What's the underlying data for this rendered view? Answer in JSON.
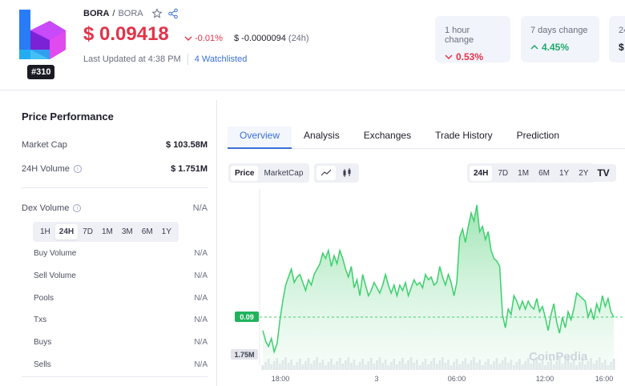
{
  "coin": {
    "name": "BORA",
    "separator": "/",
    "symbol": "BORA",
    "rank": "#310",
    "price": "$ 0.09418",
    "change_pct": "-0.01%",
    "change_abs": "$ -0.0000094",
    "change_abs_timeframe": "(24h)",
    "last_updated": "Last Updated at 4:38 PM",
    "watchlisted": "4 Watchlisted"
  },
  "stat_cards": [
    {
      "label": "1 hour change",
      "value": "0.53%",
      "direction": "down"
    },
    {
      "label": "7 days change",
      "value": "4.45%",
      "direction": "up"
    },
    {
      "label": "24",
      "value": "$"
    }
  ],
  "performance": {
    "title": "Price Performance",
    "market_cap_label": "Market Cap",
    "market_cap": "$ 103.58M",
    "volume_label": "24H Volume",
    "volume": "$ 1.751M",
    "dex_label": "Dex Volume",
    "dex_value": "N/A",
    "timeframes": [
      "1H",
      "24H",
      "7D",
      "1M",
      "3M",
      "6M",
      "1Y"
    ],
    "active_timeframe": "24H",
    "rows": [
      {
        "label": "Buy Volume",
        "value": "N/A"
      },
      {
        "label": "Sell Volume",
        "value": "N/A"
      },
      {
        "label": "Pools",
        "value": "N/A"
      },
      {
        "label": "Txs",
        "value": "N/A"
      },
      {
        "label": "Buys",
        "value": "N/A"
      },
      {
        "label": "Sells",
        "value": "N/A"
      }
    ]
  },
  "tabs": [
    "Overview",
    "Analysis",
    "Exchanges",
    "Trade History",
    "Prediction"
  ],
  "active_tab": "Overview",
  "chart_controls": {
    "metric": [
      "Price",
      "MarketCap"
    ],
    "active_metric": "Price",
    "ranges": [
      "24H",
      "7D",
      "1M",
      "6M",
      "1Y",
      "2Y"
    ],
    "active_range": "24H",
    "tv_logo": "TV"
  },
  "colors": {
    "accent": "#3b6fd6",
    "down": "#e2334a",
    "up": "#1fa86b",
    "line": "#3ccf6c",
    "area": "#bfeecd"
  },
  "chart_data": {
    "type": "area",
    "x_ticks": [
      "18:00",
      "3",
      "06:00",
      "12:00",
      "16:00"
    ],
    "current_price_label": "0.09",
    "volume_label": "1.75M",
    "watermark": "CoinPedia",
    "y_range": [
      0.0895,
      0.0955
    ],
    "values": [
      0.0905,
      0.0901,
      0.0899,
      0.0902,
      0.0897,
      0.09,
      0.0909,
      0.0916,
      0.0922,
      0.0925,
      0.0928,
      0.0923,
      0.0925,
      0.0926,
      0.0923,
      0.092,
      0.0924,
      0.0922,
      0.0926,
      0.0928,
      0.093,
      0.0934,
      0.0932,
      0.0935,
      0.0929,
      0.0933,
      0.093,
      0.0935,
      0.0932,
      0.0928,
      0.0925,
      0.0929,
      0.0921,
      0.0924,
      0.0918,
      0.0926,
      0.0922,
      0.0918,
      0.092,
      0.0923,
      0.0921,
      0.0919,
      0.0922,
      0.0926,
      0.0922,
      0.0919,
      0.0922,
      0.0918,
      0.0922,
      0.092,
      0.0923,
      0.0918,
      0.0921,
      0.0924,
      0.0922,
      0.0923,
      0.0921,
      0.0926,
      0.0924,
      0.0925,
      0.0922,
      0.0923,
      0.0929,
      0.0925,
      0.0922,
      0.0926,
      0.0923,
      0.0918,
      0.0923,
      0.094,
      0.0943,
      0.0938,
      0.0944,
      0.0949,
      0.0946,
      0.0952,
      0.0942,
      0.0944,
      0.0939,
      0.0942,
      0.0935,
      0.0932,
      0.0931,
      0.0929,
      0.0911,
      0.0906,
      0.0913,
      0.0911,
      0.0918,
      0.0916,
      0.0913,
      0.0916,
      0.0913,
      0.0916,
      0.0914,
      0.0913,
      0.0917,
      0.0912,
      0.0914,
      0.091,
      0.0905,
      0.0911,
      0.0915,
      0.0908,
      0.0904,
      0.091,
      0.0906,
      0.0912,
      0.0909,
      0.0913,
      0.0919,
      0.0918,
      0.0917,
      0.0916,
      0.091,
      0.0913,
      0.0909,
      0.0915,
      0.0912,
      0.0918,
      0.0914,
      0.0917,
      0.0912,
      0.091
    ]
  }
}
